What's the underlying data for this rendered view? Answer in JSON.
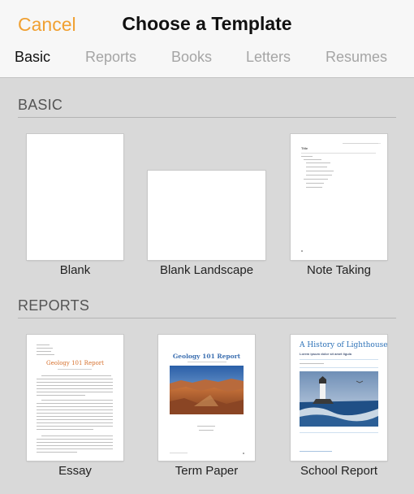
{
  "header": {
    "cancel_label": "Cancel",
    "title": "Choose a Template"
  },
  "tabs": [
    {
      "label": "Basic",
      "active": true
    },
    {
      "label": "Reports",
      "active": false
    },
    {
      "label": "Books",
      "active": false
    },
    {
      "label": "Letters",
      "active": false
    },
    {
      "label": "Resumes",
      "active": false
    }
  ],
  "sections": {
    "basic": {
      "title": "BASIC",
      "templates": [
        {
          "label": "Blank"
        },
        {
          "label": "Blank Landscape"
        },
        {
          "label": "Note Taking"
        }
      ]
    },
    "reports": {
      "title": "REPORTS",
      "templates": [
        {
          "label": "Essay"
        },
        {
          "label": "Term Paper"
        },
        {
          "label": "School Report"
        }
      ]
    }
  },
  "thumbnails": {
    "note_taking": {
      "heading": "Title"
    },
    "essay": {
      "title": "Geology 101 Report"
    },
    "term_paper": {
      "title": "Geology 101 Report"
    },
    "school_report": {
      "title": "A History of Lighthouses",
      "subtitle": "Lorem ipsum dolor sit amet ligula"
    }
  },
  "colors": {
    "accent": "#f0a032",
    "essay_title": "#d6702c",
    "report_title": "#3c6fb0",
    "lighthouse_title": "#2f73b8"
  }
}
